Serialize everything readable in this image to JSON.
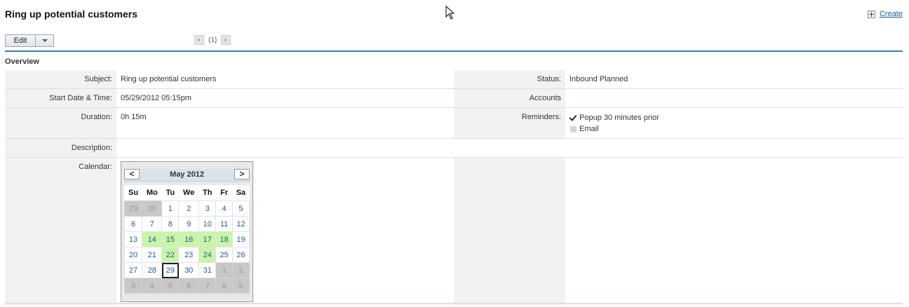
{
  "header": {
    "title": "Ring up potential customers",
    "create_label": "Create"
  },
  "toolbar": {
    "edit_label": "Edit",
    "pager_text": "(1)"
  },
  "section": {
    "title": "Overview"
  },
  "fields": {
    "subject": {
      "label": "Subject:",
      "value": "Ring up potential customers"
    },
    "status": {
      "label": "Status:",
      "value": "Inbound Planned"
    },
    "start": {
      "label": "Start Date & Time:",
      "value": "05/29/2012 05:15pm"
    },
    "accounts": {
      "label": "Accounts",
      "value": ""
    },
    "duration": {
      "label": "Duration:",
      "value": "0h 15m"
    },
    "reminders": {
      "label": "Reminders:",
      "items": [
        {
          "label": "Popup 30 minutes prior",
          "checked": true
        },
        {
          "label": "Email",
          "checked": false
        }
      ]
    },
    "description": {
      "label": "Description:",
      "value": ""
    },
    "calendar": {
      "label": "Calendar:"
    }
  },
  "calendar": {
    "month_label": "May 2012",
    "prev": "<",
    "next": ">",
    "weekdays": [
      "Su",
      "Mo",
      "Tu",
      "We",
      "Th",
      "Fr",
      "Sa"
    ],
    "weeks": [
      [
        {
          "d": "29",
          "o": true
        },
        {
          "d": "30",
          "o": true
        },
        {
          "d": "1"
        },
        {
          "d": "2"
        },
        {
          "d": "3"
        },
        {
          "d": "4"
        },
        {
          "d": "5"
        }
      ],
      [
        {
          "d": "6"
        },
        {
          "d": "7"
        },
        {
          "d": "8"
        },
        {
          "d": "9"
        },
        {
          "d": "10"
        },
        {
          "d": "11"
        },
        {
          "d": "12"
        }
      ],
      [
        {
          "d": "13"
        },
        {
          "d": "14",
          "h": true
        },
        {
          "d": "15",
          "h": true
        },
        {
          "d": "16",
          "h": true
        },
        {
          "d": "17",
          "h": true
        },
        {
          "d": "18",
          "h": true
        },
        {
          "d": "19"
        }
      ],
      [
        {
          "d": "20"
        },
        {
          "d": "21"
        },
        {
          "d": "22",
          "h": true
        },
        {
          "d": "23"
        },
        {
          "d": "24",
          "h": true
        },
        {
          "d": "25"
        },
        {
          "d": "26"
        }
      ],
      [
        {
          "d": "27"
        },
        {
          "d": "28"
        },
        {
          "d": "29",
          "t": true
        },
        {
          "d": "30"
        },
        {
          "d": "31"
        },
        {
          "d": "1",
          "o": true
        },
        {
          "d": "2",
          "o": true
        }
      ],
      [
        {
          "d": "3",
          "o": true
        },
        {
          "d": "4",
          "o": true
        },
        {
          "d": "5",
          "o": true
        },
        {
          "d": "6",
          "o": true
        },
        {
          "d": "7",
          "o": true
        },
        {
          "d": "8",
          "o": true
        },
        {
          "d": "9",
          "o": true
        }
      ]
    ]
  }
}
